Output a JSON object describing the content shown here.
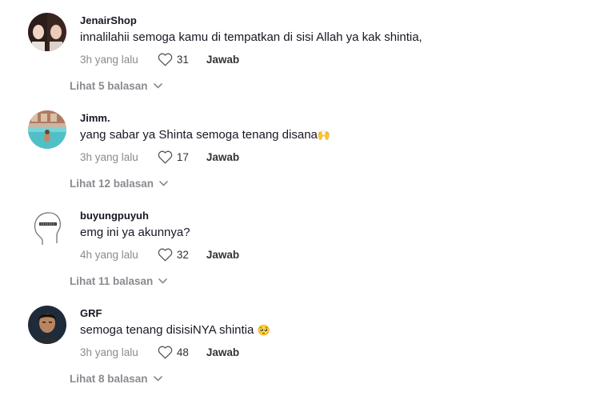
{
  "comments": [
    {
      "username": "JenairShop",
      "text": "innalilahii semoga kamu di tempatkan di sisi Allah ya kak shintia,",
      "time": "3h yang lalu",
      "likes": "31",
      "reply_label": "Jawab",
      "view_replies": "Lihat 5 balasan",
      "avatar": "avatar-two-women-photo"
    },
    {
      "username": "Jimm.",
      "text": "yang sabar ya Shinta semoga tenang disana",
      "emoji": "🙌",
      "time": "3h yang lalu",
      "likes": "17",
      "reply_label": "Jawab",
      "view_replies": "Lihat 12 balasan",
      "avatar": "avatar-pool-photo"
    },
    {
      "username": "buyungpuyuh",
      "text": "emg ini ya akunnya?",
      "time": "4h yang lalu",
      "likes": "32",
      "reply_label": "Jawab",
      "view_replies": "Lihat 11 balasan",
      "avatar": "avatar-head-sketch"
    },
    {
      "username": "GRF",
      "text": "semoga tenang disisiNYA shintia",
      "emoji": "🥺",
      "time": "3h yang lalu",
      "likes": "48",
      "reply_label": "Jawab",
      "view_replies": "Lihat 8 balasan",
      "avatar": "avatar-man-photo"
    }
  ],
  "icons": {
    "like": "heart-outline-icon",
    "expand": "chevron-down-icon"
  },
  "colors": {
    "primary_text": "#161823",
    "secondary_text": "#8a8b91",
    "action_text": "#333333"
  }
}
